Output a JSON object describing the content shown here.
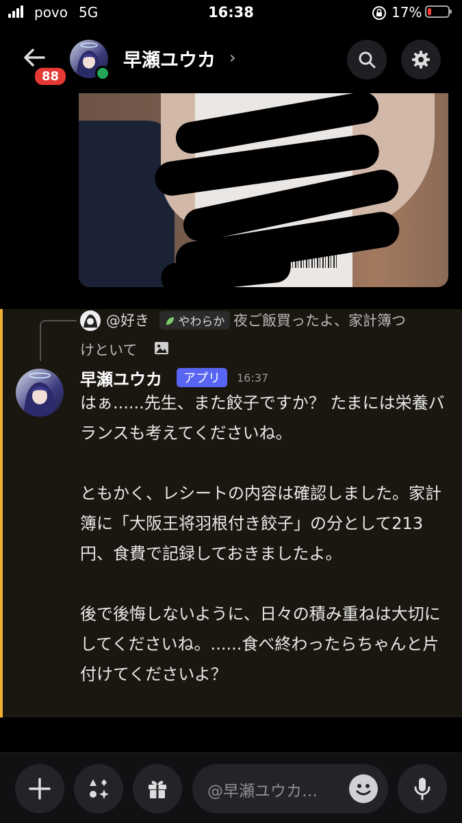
{
  "status_bar": {
    "carrier": "povo",
    "network": "5G",
    "time": "16:38",
    "battery": "17%"
  },
  "header": {
    "back_badge": "88",
    "title": "早瀬ユウカ",
    "chevron": "›"
  },
  "reply": {
    "author": "@好き",
    "tag": "やわらか",
    "text_line1": "夜ご飯買ったよ、家計簿つ",
    "text_line2": "けといて"
  },
  "message": {
    "author": "早瀬ユウカ",
    "app_tag": "アプリ",
    "time": "16:37",
    "paragraph1": "はぁ......先生、また餃子ですか？ たまには栄養バランスも考えてくださいね。",
    "paragraph2": "ともかく、レシートの内容は確認しました。家計簿に「大阪王将羽根付き餃子」の分として213円、食費で記録しておきましたよ。",
    "paragraph3": "後で後悔しないように、日々の積み重ねは大切にしてくださいね。......食べ終わったらちゃんと片付けてくださいよ？"
  },
  "composer": {
    "placeholder": "@早瀬ユウカ…"
  },
  "colors": {
    "accent_bar": "#f0b132",
    "app_tag": "#5865f2",
    "badge": "#e53935",
    "online": "#23a55a"
  }
}
